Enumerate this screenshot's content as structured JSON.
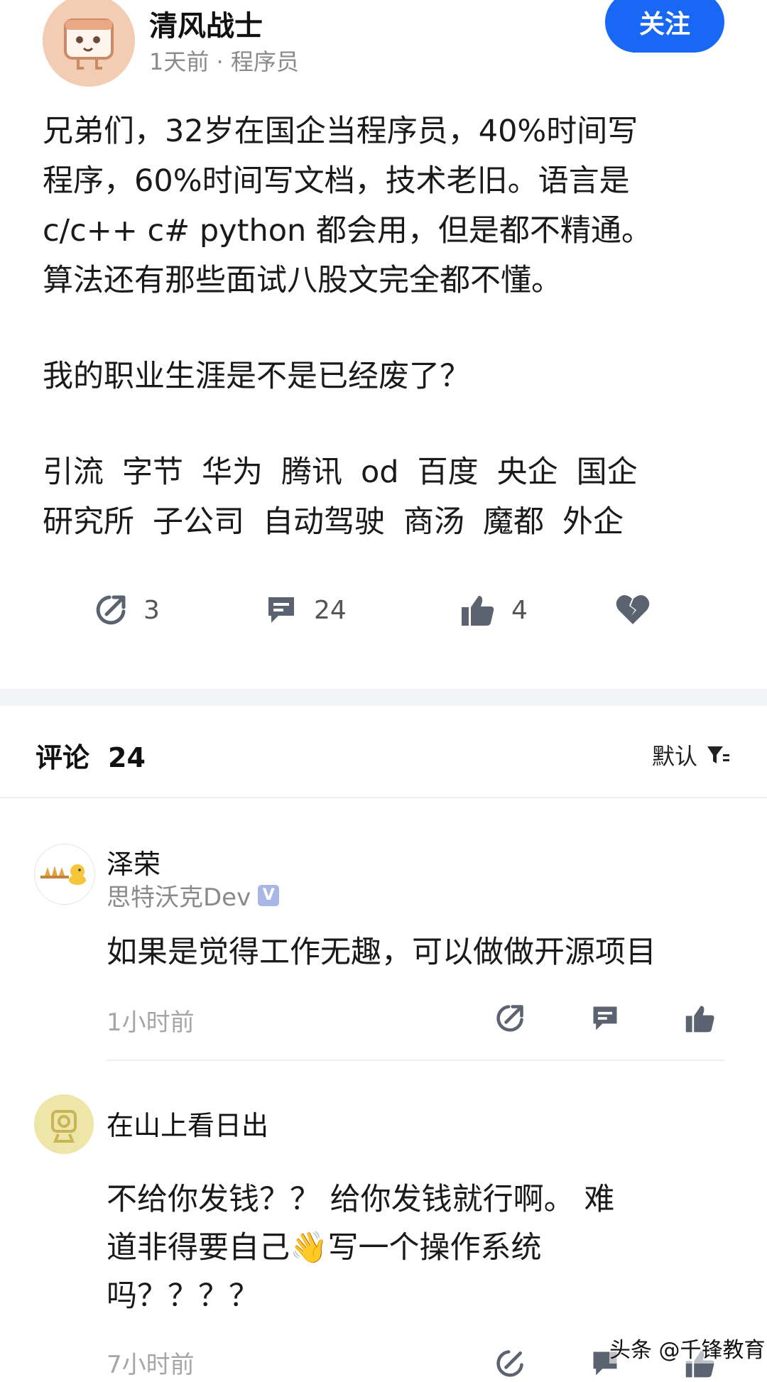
{
  "post": {
    "author": "清风战士",
    "meta": "1天前 · 程序员",
    "follow_label": "关注",
    "body_lines": [
      "兄弟们，32岁在国企当程序员，40%时间写",
      "程序，60%时间写文档，技术老旧。语言是",
      "c/c++  c#  python  都会用，但是都不精通。",
      "算法还有那些面试八股文完全都不懂。"
    ],
    "question": "我的职业生涯是不是已经废了？",
    "tags": [
      "引流",
      "字节",
      "华为",
      "腾讯",
      "od",
      "百度",
      "央企",
      "国企",
      "研究所",
      "子公司",
      "自动驾驶",
      "商汤",
      "魔都",
      "外企"
    ],
    "actions": {
      "share_count": "3",
      "comment_count": "24",
      "like_count": "4"
    }
  },
  "comments_header": {
    "title": "评论",
    "count": "24",
    "sort_label": "默认"
  },
  "comments": [
    {
      "name": "泽荣",
      "subtitle": "思特沃克Dev",
      "verified_glyph": "V",
      "text": "如果是觉得工作无趣，可以做做开源项目",
      "time": "1小时前"
    },
    {
      "name": "在山上看日出",
      "text_lines": [
        "不给你发钱？？   给你发钱就行啊。  难",
        "道非得要自己👋写一个操作系统",
        "吗？？？？"
      ],
      "time": "7小时前"
    }
  ],
  "watermark": "头条 @千锋教育",
  "colors": {
    "accent": "#1867f5",
    "icon_gray": "#5b6270",
    "meta_gray": "#8a8a8a"
  }
}
